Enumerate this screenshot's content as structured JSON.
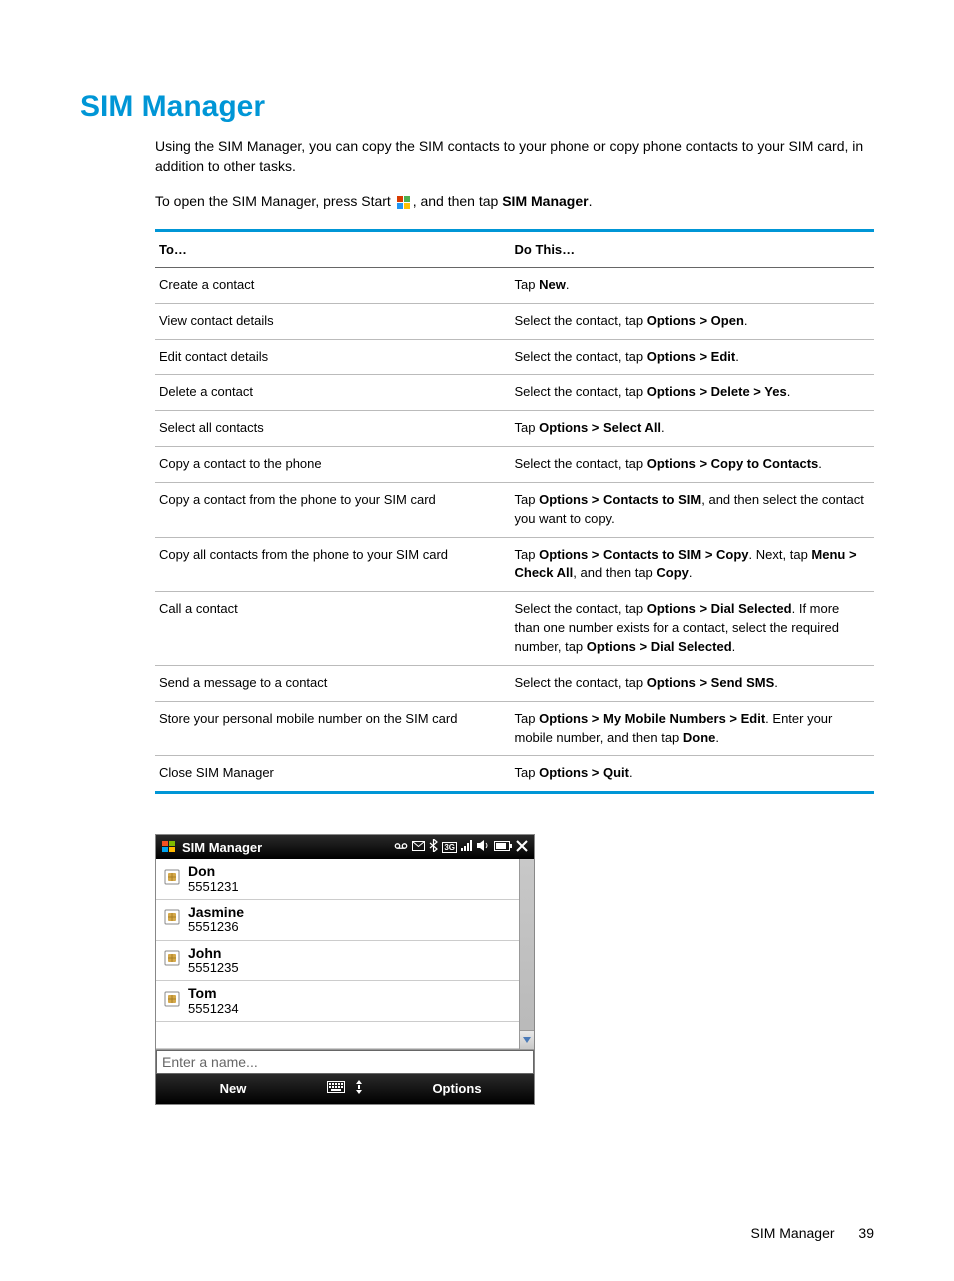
{
  "heading": "SIM Manager",
  "intro": "Using the SIM Manager, you can copy the SIM contacts to your phone or copy phone contacts to your SIM card, in addition to other tasks.",
  "open_pre": "To open the SIM Manager, press Start ",
  "open_post": ", and then tap ",
  "open_bold": "SIM Manager",
  "open_end": ".",
  "table": {
    "h1": "To…",
    "h2": "Do This…",
    "rows": [
      {
        "task": "Create a contact",
        "do": [
          {
            "t": "Tap "
          },
          {
            "b": "New"
          },
          {
            "t": "."
          }
        ]
      },
      {
        "task": "View contact details",
        "do": [
          {
            "t": "Select the contact, tap "
          },
          {
            "b": "Options > Open"
          },
          {
            "t": "."
          }
        ]
      },
      {
        "task": "Edit contact details",
        "do": [
          {
            "t": "Select the contact, tap "
          },
          {
            "b": "Options > Edit"
          },
          {
            "t": "."
          }
        ]
      },
      {
        "task": "Delete a contact",
        "do": [
          {
            "t": "Select the contact, tap "
          },
          {
            "b": "Options > Delete > Yes"
          },
          {
            "t": "."
          }
        ]
      },
      {
        "task": "Select all contacts",
        "do": [
          {
            "t": "Tap "
          },
          {
            "b": "Options > Select All"
          },
          {
            "t": "."
          }
        ]
      },
      {
        "task": "Copy a contact to the phone",
        "do": [
          {
            "t": "Select the contact, tap "
          },
          {
            "b": "Options > Copy to Contacts"
          },
          {
            "t": "."
          }
        ]
      },
      {
        "task": "Copy a contact from the phone to your SIM card",
        "do": [
          {
            "t": "Tap "
          },
          {
            "b": "Options > Contacts to SIM"
          },
          {
            "t": ", and then select the contact you want to copy."
          }
        ]
      },
      {
        "task": "Copy all contacts from the phone to your SIM card",
        "do": [
          {
            "t": "Tap "
          },
          {
            "b": "Options > Contacts to SIM > Copy"
          },
          {
            "t": ". Next, tap "
          },
          {
            "b": "Menu > Check All"
          },
          {
            "t": ", and then tap "
          },
          {
            "b": "Copy"
          },
          {
            "t": "."
          }
        ]
      },
      {
        "task": "Call a contact",
        "do": [
          {
            "t": "Select the contact, tap "
          },
          {
            "b": "Options > Dial Selected"
          },
          {
            "t": ". If more than one number exists for a contact, select the required number, tap "
          },
          {
            "b": "Options > Dial Selected"
          },
          {
            "t": "."
          }
        ]
      },
      {
        "task": "Send a message to a contact",
        "do": [
          {
            "t": "Select the contact, tap "
          },
          {
            "b": "Options > Send SMS"
          },
          {
            "t": "."
          }
        ]
      },
      {
        "task": "Store your personal mobile number on the SIM card",
        "do": [
          {
            "t": "Tap "
          },
          {
            "b": "Options > My Mobile Numbers > Edit"
          },
          {
            "t": ". Enter your mobile number, and then tap "
          },
          {
            "b": "Done"
          },
          {
            "t": "."
          }
        ]
      },
      {
        "task": "Close SIM Manager",
        "do": [
          {
            "t": "Tap "
          },
          {
            "b": "Options > Quit"
          },
          {
            "t": "."
          }
        ]
      }
    ]
  },
  "phone": {
    "title": "SIM Manager",
    "contacts": [
      {
        "name": "Don",
        "number": "5551231"
      },
      {
        "name": "Jasmine",
        "number": "5551236"
      },
      {
        "name": "John",
        "number": "5551235"
      },
      {
        "name": "Tom",
        "number": "5551234"
      }
    ],
    "placeholder": "Enter a name...",
    "btn_new": "New",
    "btn_options": "Options"
  },
  "footer": {
    "label": "SIM Manager",
    "page": "39"
  }
}
